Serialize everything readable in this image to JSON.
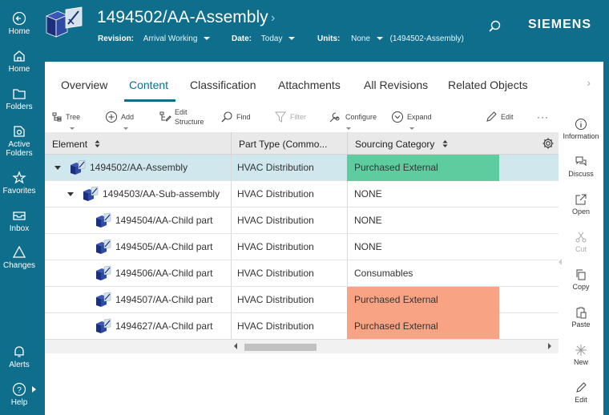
{
  "nav": [
    {
      "label": "Home",
      "icon": "home-circle-icon"
    },
    {
      "label": "Home",
      "icon": "house-icon"
    },
    {
      "label": "Folders",
      "icon": "folder-icon"
    },
    {
      "label": "Active Folders",
      "icon": "active-folder-icon"
    },
    {
      "label": "Favorites",
      "icon": "star-icon"
    },
    {
      "label": "Inbox",
      "icon": "inbox-icon"
    },
    {
      "label": "Changes",
      "icon": "changes-icon"
    },
    {
      "label": "Alerts",
      "icon": "bell-icon"
    },
    {
      "label": "Help",
      "icon": "help-icon"
    }
  ],
  "header": {
    "title": "1494502/AA-Assembly",
    "revision_label": "Revision:",
    "revision_value": "Arrival Working",
    "date_label": "Date:",
    "date_value": "Today",
    "units_label": "Units:",
    "units_value": "None",
    "context": "(1494502-Assembly)",
    "brand": "SIEMENS"
  },
  "tabs": [
    "Overview",
    "Content",
    "Classification",
    "Attachments",
    "All Revisions",
    "Related Objects"
  ],
  "toolbar": {
    "tree": "Tree",
    "add": "Add",
    "edit_structure_1": "Edit",
    "edit_structure_2": "Structure",
    "find": "Find",
    "filter": "Filter",
    "configure": "Configure",
    "expand": "Expand",
    "edit": "Edit",
    "more": "···"
  },
  "grid": {
    "columns": [
      "Element",
      "Part Type (Commo...",
      "Sourcing Category"
    ],
    "rows": [
      {
        "element": "1494502/AA-Assembly",
        "part_type": "HVAC Distribution",
        "sourcing": "Purchased External",
        "level": 0,
        "expanded": true
      },
      {
        "element": "1494503/AA-Sub-assembly",
        "part_type": "HVAC Distribution",
        "sourcing": "NONE",
        "level": 1,
        "expanded": true
      },
      {
        "element": "1494504/AA-Child part",
        "part_type": "HVAC Distribution",
        "sourcing": "NONE",
        "level": 2
      },
      {
        "element": "1494505/AA-Child part",
        "part_type": "HVAC Distribution",
        "sourcing": "NONE",
        "level": 2
      },
      {
        "element": "1494506/AA-Child part",
        "part_type": "HVAC Distribution",
        "sourcing": "Consumables",
        "level": 2
      },
      {
        "element": "1494507/AA-Child part",
        "part_type": "HVAC Distribution",
        "sourcing": "Purchased External",
        "level": 2
      },
      {
        "element": "1494627/AA-Child part",
        "part_type": "HVAC Distribution",
        "sourcing": "Purchased External",
        "level": 2
      }
    ]
  },
  "rail": [
    "Information",
    "Discuss",
    "Open",
    "Cut",
    "Copy",
    "Paste",
    "New",
    "Edit"
  ],
  "colors": {
    "accent": "#0e6e8c",
    "highlight_green": "#5fcca0",
    "highlight_orange": "#f8a383",
    "selected_row": "#cfe7ed"
  }
}
